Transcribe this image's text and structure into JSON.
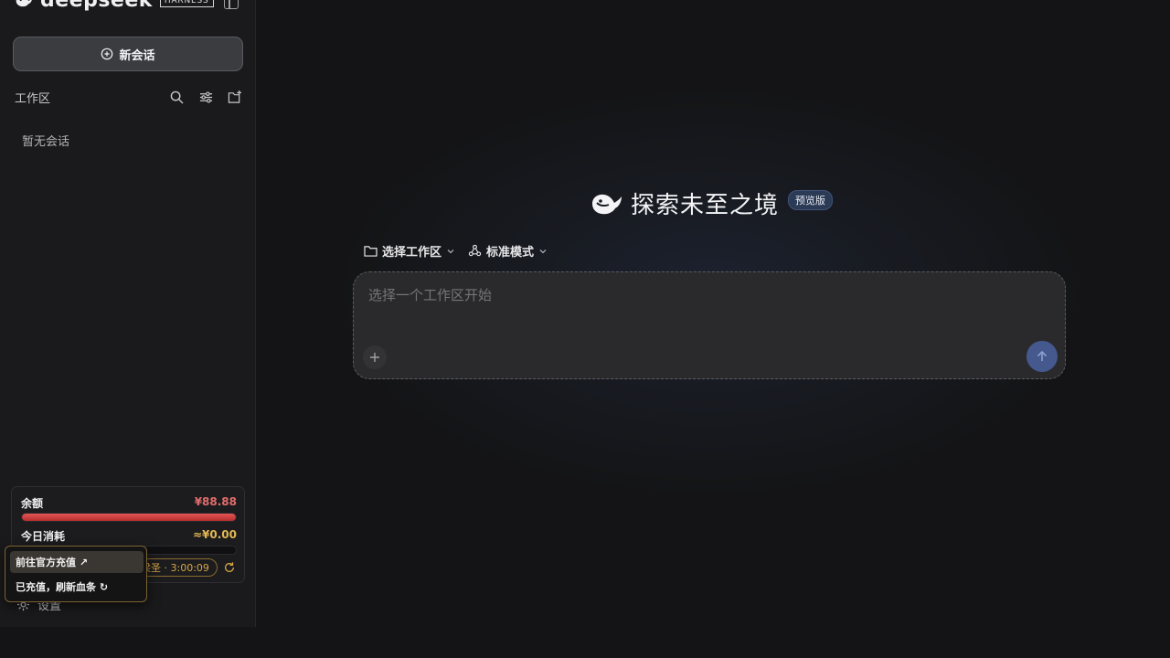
{
  "brand": {
    "name": "deepseek",
    "badge": "HARNESS"
  },
  "sidebar": {
    "new_chat_label": "新会话",
    "workspace_title": "工作区",
    "empty_text": "暂无会话",
    "settings_label": "设置"
  },
  "balance": {
    "balance_label": "余额",
    "balance_value": "¥88.88",
    "balance_fraction": 1.0,
    "today_label": "今日消耗",
    "today_value": "≈¥0.00",
    "today_fraction": 0.0,
    "timer_text": "梁圣 · 3:00:09"
  },
  "popup": {
    "recharge_label": "前往官方充值 ↗",
    "refresh_label": "已充值，刷新血条 ↻"
  },
  "main": {
    "hero_title": "探索未至之境",
    "hero_badge": "预览版",
    "workspace_select": "选择工作区",
    "mode_select": "标准模式",
    "input_placeholder": "选择一个工作区开始"
  },
  "colors": {
    "accent": "#45598f",
    "balance_red": "#e36d6d",
    "today_gold": "#e2b755",
    "popup_border": "#7a6333"
  },
  "icons": [
    "deepseek-logo-icon",
    "sidebar-toggle-icon",
    "plus-circle-icon",
    "search-icon",
    "filter-icon",
    "new-folder-icon",
    "refresh-icon",
    "gear-icon",
    "folder-icon",
    "mode-icon",
    "chevron-down-icon",
    "plus-icon",
    "arrow-up-icon"
  ]
}
